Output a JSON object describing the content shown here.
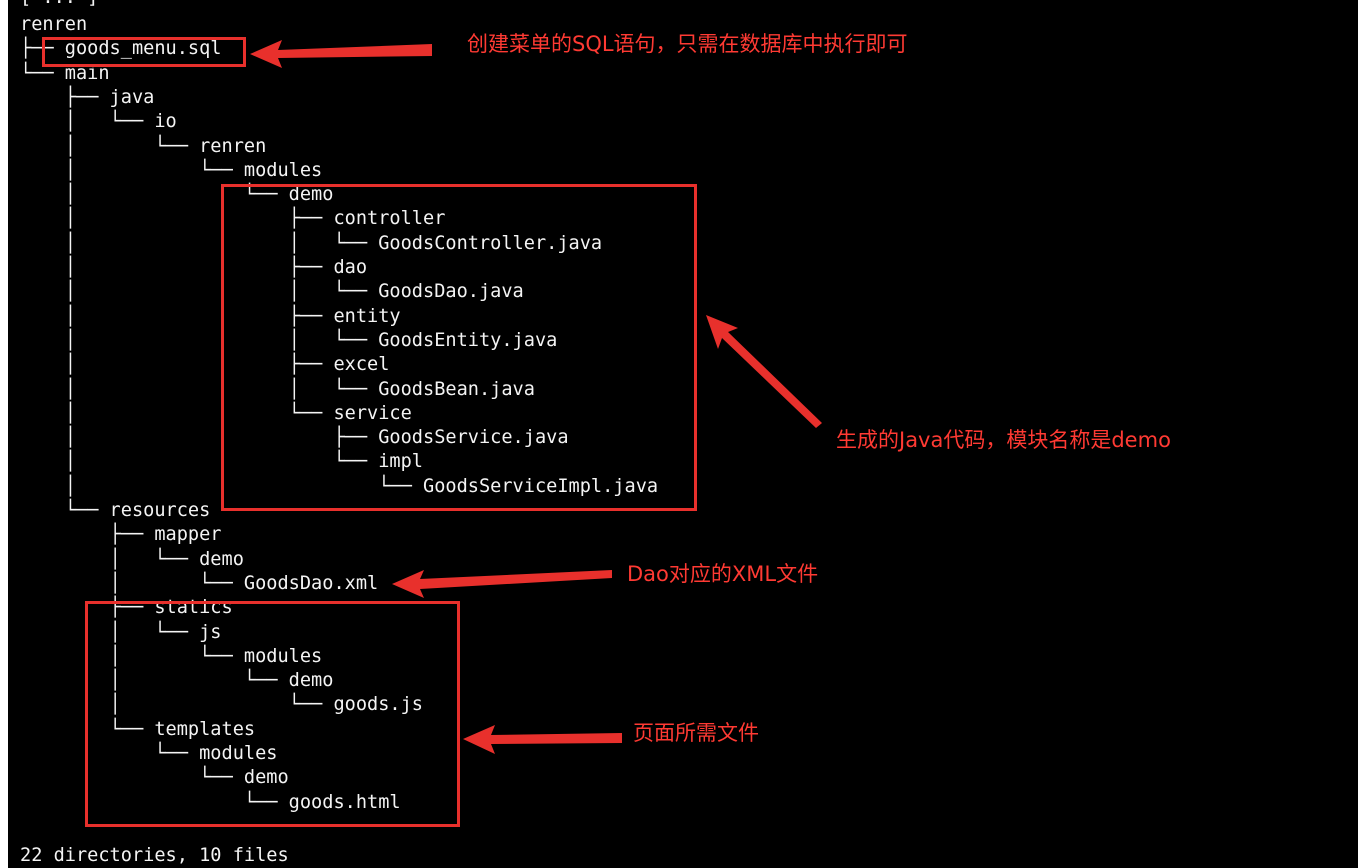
{
  "terminal": {
    "header_fragment": "[ ... ]",
    "tree_lines": [
      "renren",
      "├── goods_menu.sql",
      "└── main",
      "    ├── java",
      "    │   └── io",
      "    │       └── renren",
      "    │           └── modules",
      "    │               └── demo",
      "    │                   ├── controller",
      "    │                   │   └── GoodsController.java",
      "    │                   ├── dao",
      "    │                   │   └── GoodsDao.java",
      "    │                   ├── entity",
      "    │                   │   └── GoodsEntity.java",
      "    │                   ├── excel",
      "    │                   │   └── GoodsBean.java",
      "    │                   └── service",
      "    │                       ├── GoodsService.java",
      "    │                       └── impl",
      "    │                           └── GoodsServiceImpl.java",
      "    └── resources",
      "        ├── mapper",
      "        │   └── demo",
      "        │       └── GoodsDao.xml",
      "        ├── statics",
      "        │   └── js",
      "        │       └── modules",
      "        │           └── demo",
      "        │               └── goods.js",
      "        └── templates",
      "            └── modules",
      "                └── demo",
      "                    └── goods.html"
    ],
    "summary": "22 directories, 10 files"
  },
  "annotations": {
    "sql_note": "创建菜单的SQL语句，只需在数据库中执行即可",
    "java_note": "生成的Java代码，模块名称是demo",
    "dao_xml_note": "Dao对应的XML文件",
    "page_files_note": "页面所需文件"
  },
  "colors": {
    "terminal_bg": "#000000",
    "terminal_text": "#f4f4f4",
    "annotation_red": "#ff3a33",
    "box_red": "#e8302c"
  }
}
